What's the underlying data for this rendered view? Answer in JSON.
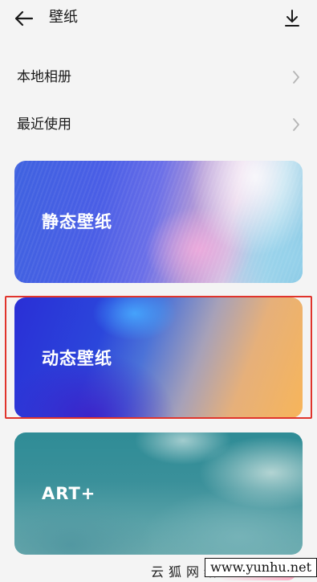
{
  "header": {
    "title": "壁纸",
    "back_icon": "arrow-left-icon",
    "download_icon": "download-icon"
  },
  "list": [
    {
      "label": "本地相册",
      "icon": "chevron-right-icon"
    },
    {
      "label": "最近使用",
      "icon": "chevron-right-icon"
    }
  ],
  "cards": [
    {
      "label": "静态壁纸"
    },
    {
      "label": "动态壁纸",
      "highlighted": true
    },
    {
      "label": "ART+"
    }
  ],
  "colors": {
    "highlight_border": "#e0342c",
    "background": "#f4f4f4"
  },
  "watermark": {
    "cn_text": "云狐网络",
    "url": "www.yunhu.net"
  }
}
